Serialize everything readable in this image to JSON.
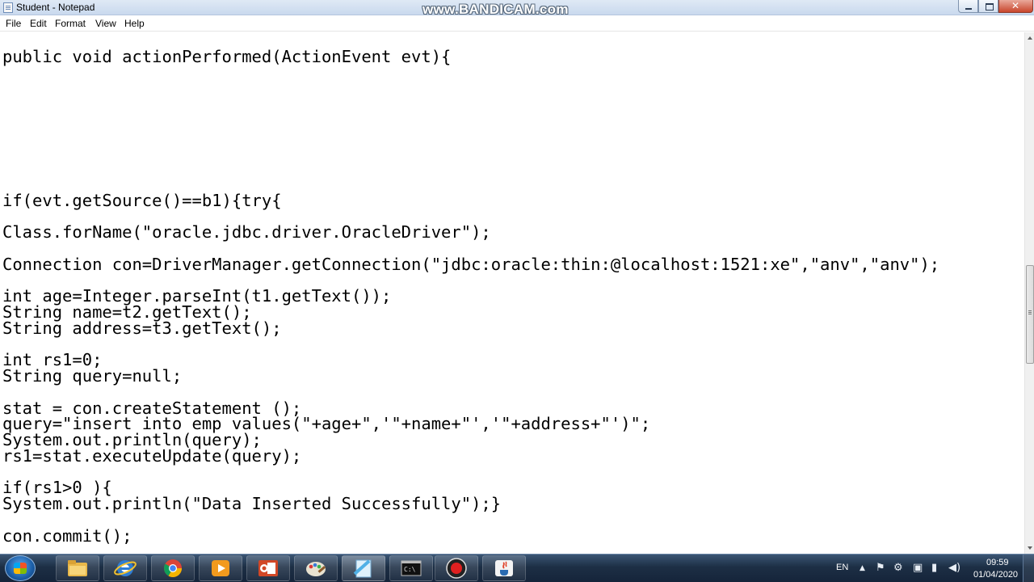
{
  "window": {
    "title": "Student - Notepad",
    "watermark": "www.BANDICAM.com"
  },
  "menu": [
    "File",
    "Edit",
    "Format",
    "View",
    "Help"
  ],
  "editor": {
    "lines": [
      "public void actionPerformed(ActionEvent evt){",
      "",
      "",
      "",
      "",
      "",
      "",
      "",
      "",
      "if(evt.getSource()==b1){try{",
      "",
      "Class.forName(\"oracle.jdbc.driver.OracleDriver\");",
      "",
      "Connection con=DriverManager.getConnection(\"jdbc:oracle:thin:@localhost:1521:xe\",\"anv\",\"anv\");",
      "",
      "int age=Integer.parseInt(t1.getText());",
      "String name=t2.getText();",
      "String address=t3.getText();",
      "",
      "int rs1=0;",
      "String query=null;",
      "",
      "stat = con.createStatement ();",
      "query=\"insert into emp values(\"+age+\",'\"+name+\"','\"+address+\"')\";",
      "System.out.println(query);",
      "rs1=stat.executeUpdate(query);",
      "",
      "if(rs1>0 ){",
      "System.out.println(\"Data Inserted Successfully\");}",
      "",
      "con.commit();"
    ]
  },
  "taskbar": {
    "apps": [
      {
        "name": "file-explorer-icon"
      },
      {
        "name": "internet-explorer-icon"
      },
      {
        "name": "chrome-icon"
      },
      {
        "name": "media-player-icon"
      },
      {
        "name": "powerpoint-icon"
      },
      {
        "name": "paint-icon"
      },
      {
        "name": "notepad-icon"
      },
      {
        "name": "command-prompt-icon"
      },
      {
        "name": "bandicam-icon"
      },
      {
        "name": "java-icon"
      }
    ],
    "language": "EN",
    "time": "09:59",
    "date": "01/04/2020"
  }
}
